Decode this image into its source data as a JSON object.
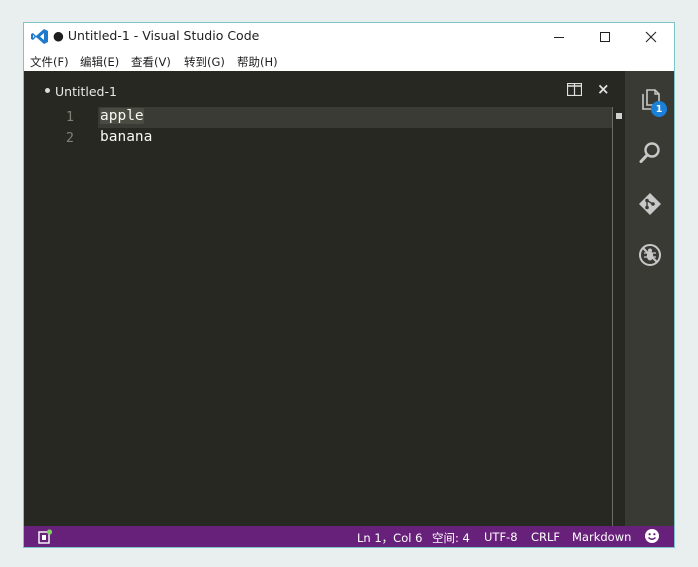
{
  "window": {
    "title": "● Untitled-1 - Visual Studio Code",
    "controls": [
      "minimize",
      "maximize",
      "close"
    ]
  },
  "menu": {
    "items": [
      "文件(F)",
      "编辑(E)",
      "查看(V)",
      "转到(G)",
      "帮助(H)"
    ]
  },
  "tab": {
    "label": "Untitled-1",
    "dirty": true
  },
  "editor": {
    "lines": [
      {
        "number": "1",
        "text": "apple"
      },
      {
        "number": "2",
        "text": "banana"
      }
    ]
  },
  "activity": {
    "items": [
      "explorer-icon",
      "search-icon",
      "git-icon",
      "debug-icon"
    ],
    "explorer_badge": "1"
  },
  "status": {
    "position": "Ln 1，Col 6",
    "indent": "空间: 4",
    "encoding": "UTF-8",
    "eol": "CRLF",
    "language": "Markdown"
  },
  "colors": {
    "editor_bg": "#272822",
    "activity_bg": "#393a34",
    "status_bg": "#68217a",
    "badge_bg": "#1b80d8",
    "vscode_blue": "#1f7acc"
  }
}
